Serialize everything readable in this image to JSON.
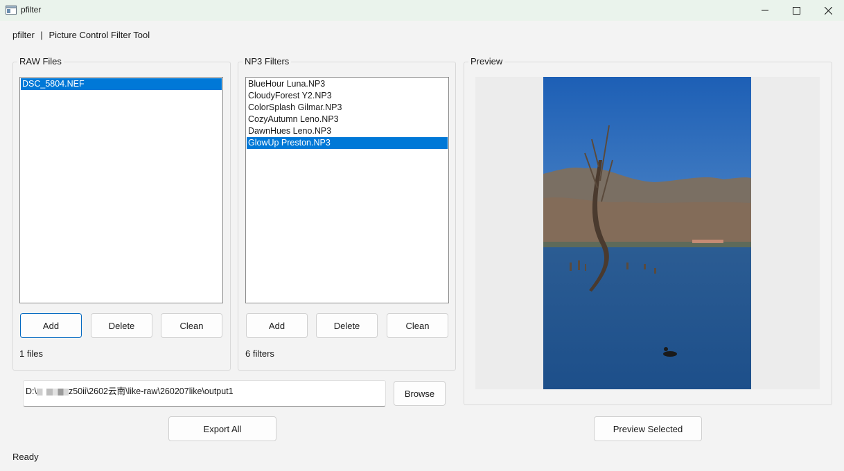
{
  "window": {
    "title": "pfilter",
    "icon": "app-window-icon",
    "controls": [
      "minimize-icon",
      "maximize-icon",
      "close-icon"
    ]
  },
  "header": {
    "app_name": "pfilter",
    "separator": "|",
    "subtitle": "Picture Control Filter Tool"
  },
  "raw_files": {
    "title": "RAW Files",
    "items": [
      "DSC_5804.NEF"
    ],
    "selected_index": 0,
    "add_label": "Add",
    "delete_label": "Delete",
    "clean_label": "Clean",
    "count_text": "1 files"
  },
  "np3_filters": {
    "title": "NP3 Filters",
    "items": [
      "BlueHour Luna.NP3",
      "CloudyForest Y2.NP3",
      "ColorSplash Gilmar.NP3",
      "CozyAutumn Leno.NP3",
      "DawnHues Leno.NP3",
      "GlowUp Preston.NP3"
    ],
    "selected_index": 5,
    "add_label": "Add",
    "delete_label": "Delete",
    "clean_label": "Clean",
    "count_text": "6 filters"
  },
  "output": {
    "path_prefix": "D:\\",
    "path_suffix": "z50ii\\2602云南\\like-raw\\260207like\\output1",
    "browse_label": "Browse",
    "export_label": "Export All"
  },
  "preview": {
    "title": "Preview",
    "button_label": "Preview Selected"
  },
  "status": {
    "text": "Ready"
  },
  "colors": {
    "selection": "#0078d7",
    "titlebar": "#eaf3ec",
    "window_bg": "#f3f3f3",
    "focus_border": "#0067c0"
  }
}
